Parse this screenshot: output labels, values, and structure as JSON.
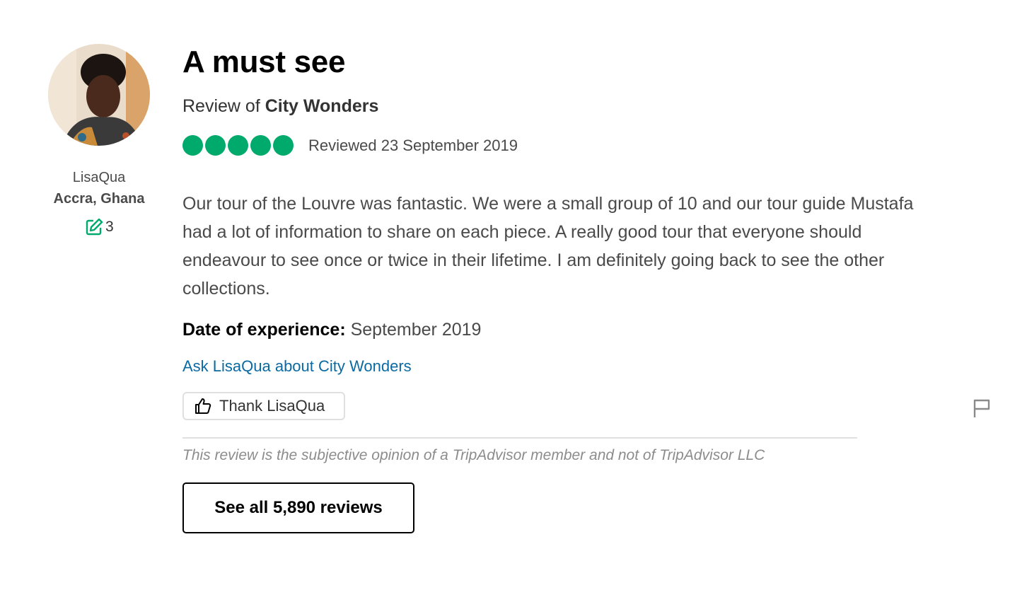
{
  "reviewer": {
    "avatar_icon": "user-avatar-photo",
    "name": "LisaQua",
    "location": "Accra, Ghana",
    "contributions_icon": "edit-icon",
    "contributions_count": "3"
  },
  "review": {
    "title": "A must see",
    "review_of_prefix": "Review of ",
    "review_of_name": "City Wonders",
    "rating_bubbles": 5,
    "rating_color": "#00aa6c",
    "reviewed_date": "Reviewed 23 September 2019",
    "body_lines": [
      "Our tour of the Louvre was fantastic. We were a small group of 10 and our tour guide Mustafa",
      "had a lot of information to share on each piece. A really good tour that everyone should",
      "endeavour to see once or twice in their lifetime. I am definitely going back to see the other",
      "collections."
    ],
    "experience_label": "Date of experience:",
    "experience_value": " September 2019"
  },
  "actions": {
    "ask_link": "Ask LisaQua about City Wonders",
    "ask_link_color": "#0a6aa1",
    "thank_icon": "thumbs-up-icon",
    "thank_label": "Thank LisaQua",
    "report_icon": "flag-icon"
  },
  "footer": {
    "disclaimer": "This review is the subjective opinion of a TripAdvisor member and not of TripAdvisor LLC",
    "see_all_label": "See all 5,890 reviews"
  }
}
